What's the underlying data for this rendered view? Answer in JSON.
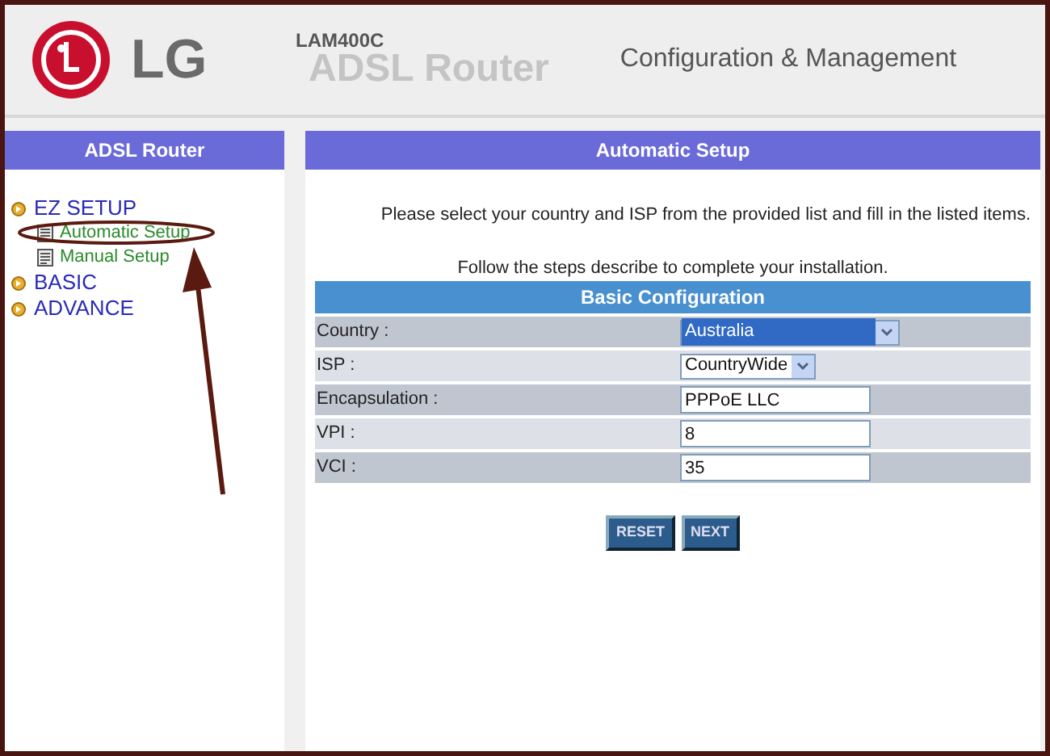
{
  "header": {
    "brand": "LG",
    "model": "LAM400C",
    "product": "ADSL Router",
    "tagline": "Configuration & Management"
  },
  "sidebar": {
    "title": "ADSL Router",
    "items": [
      {
        "label": "EZ SETUP",
        "expanded": true,
        "children": [
          {
            "label": "Automatic Setup"
          },
          {
            "label": "Manual Setup"
          }
        ]
      },
      {
        "label": "BASIC",
        "expanded": false
      },
      {
        "label": "ADVANCE",
        "expanded": false
      }
    ]
  },
  "main": {
    "title": "Automatic Setup",
    "intro": "Please select your country and ISP from the provided list and fill in the listed items.",
    "steps": "Follow the steps describe to complete your installation.",
    "form": {
      "title": "Basic Configuration",
      "rows": [
        {
          "label": "Country :",
          "kind": "select",
          "value": "Australia",
          "highlighted": true
        },
        {
          "label": "ISP :",
          "kind": "select",
          "value": "CountryWide",
          "highlighted": false
        },
        {
          "label": "Encapsulation :",
          "kind": "text",
          "value": "PPPoE LLC"
        },
        {
          "label": "VPI :",
          "kind": "text",
          "value": "8"
        },
        {
          "label": "VCI :",
          "kind": "text",
          "value": "35"
        }
      ]
    },
    "buttons": [
      "RESET",
      "NEXT"
    ]
  }
}
